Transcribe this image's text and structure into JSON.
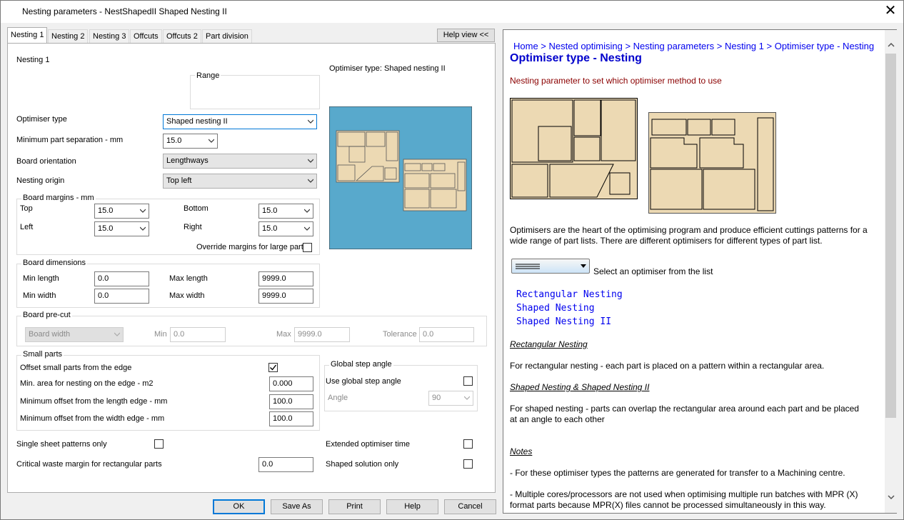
{
  "window": {
    "title": "Nesting parameters - NestShapedII Shaped Nesting II"
  },
  "tabs": [
    {
      "label": "Nesting 1"
    },
    {
      "label": "Nesting 2"
    },
    {
      "label": "Nesting 3"
    },
    {
      "label": "Offcuts"
    },
    {
      "label": "Offcuts 2"
    },
    {
      "label": "Part division"
    }
  ],
  "help_view_button": "Help view <<",
  "form": {
    "section_title": "Nesting 1",
    "range_label": "Range",
    "optimiser_preview_label": "Optimiser type: Shaped nesting II",
    "optimiser_type": {
      "label": "Optimiser type",
      "value": "Shaped nesting II"
    },
    "min_part_separation": {
      "label": "Minimum part separation - mm",
      "value": "15.0"
    },
    "board_orientation": {
      "label": "Board orientation",
      "value": "Lengthways"
    },
    "nesting_origin": {
      "label": "Nesting origin",
      "value": "Top left"
    },
    "board_margins": {
      "title": "Board margins - mm",
      "top": {
        "label": "Top",
        "value": "15.0"
      },
      "bottom": {
        "label": "Bottom",
        "value": "15.0"
      },
      "left": {
        "label": "Left",
        "value": "15.0"
      },
      "right": {
        "label": "Right",
        "value": "15.0"
      },
      "override_label": "Override margins for large parts"
    },
    "board_dimensions": {
      "title": "Board dimensions",
      "min_length": {
        "label": "Min length",
        "value": "0.0"
      },
      "max_length": {
        "label": "Max length",
        "value": "9999.0"
      },
      "min_width": {
        "label": "Min width",
        "value": "0.0"
      },
      "max_width": {
        "label": "Max width",
        "value": "9999.0"
      }
    },
    "board_precut": {
      "title": "Board pre-cut",
      "mode": "Board width",
      "min": {
        "label": "Min",
        "value": "0.0"
      },
      "max": {
        "label": "Max",
        "value": "9999.0"
      },
      "tolerance": {
        "label": "Tolerance",
        "value": "0.0"
      }
    },
    "small_parts": {
      "title": "Small parts",
      "offset_label": "Offset small parts from the edge",
      "offset_checked": true,
      "min_area": {
        "label": "Min. area for nesting on the edge - m2",
        "value": "0.000"
      },
      "min_offset_length": {
        "label": "Minimum offset from the length edge - mm",
        "value": "100.0"
      },
      "min_offset_width": {
        "label": "Minimum offset from the width edge - mm",
        "value": "100.0"
      }
    },
    "global_step": {
      "title": "Global step angle",
      "use_label": "Use global step angle",
      "angle_label": "Angle",
      "angle_value": "90"
    },
    "single_sheet_label": "Single sheet patterns only",
    "extended_time_label": "Extended optimiser time",
    "critical_waste": {
      "label": "Critical waste margin for rectangular parts",
      "value": "0.0"
    },
    "shaped_solution_label": "Shaped solution only"
  },
  "buttons": {
    "ok": "OK",
    "save_as": "Save As",
    "print": "Print",
    "help": "Help",
    "cancel": "Cancel"
  },
  "help": {
    "breadcrumb": [
      "Home",
      "Nested optimising",
      "Nesting parameters",
      "Nesting 1",
      "Optimiser type - Nesting"
    ],
    "title": "Optimiser type - Nesting",
    "subtitle": "Nesting parameter to set which optimiser method to use",
    "intro": "Optimisers are the heart of the optimising program and produce efficient cuttings patterns for a wide range of part lists. There are different optimisers for different types of part list.",
    "select_text": "Select an optimiser from the list",
    "links": [
      "Rectangular Nesting",
      "Shaped Nesting",
      "Shaped Nesting II"
    ],
    "rect_heading": "Rectangular Nesting",
    "rect_text": "For rectangular nesting - each part is placed on a pattern within a rectangular area.",
    "shaped_heading": "Shaped Nesting & Shaped Nesting II",
    "shaped_text": "For shaped nesting - parts can overlap the rectangular area around each part and be placed at an angle to each other",
    "notes_heading": "Notes",
    "note1": "- For these optimiser types the patterns are generated for transfer to a Machining centre.",
    "note2": "- Multiple cores/processors are not used when optimising multiple run batches with MPR (X) format parts because MPR(X) files cannot be processed simultaneously in this way."
  },
  "colors": {
    "preview_bg": "#58a9cc",
    "part_fill": "#ecd9b3",
    "link": "#0000ee",
    "subtitle": "#8b0000",
    "title_blue": "#0000cc"
  }
}
